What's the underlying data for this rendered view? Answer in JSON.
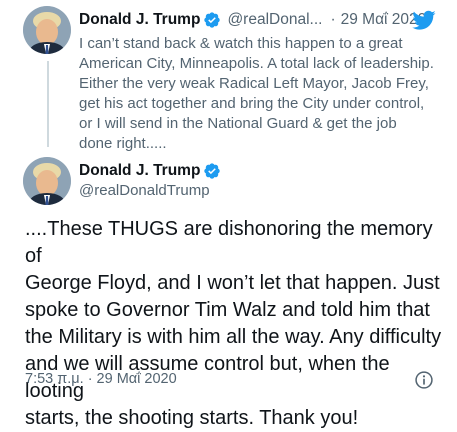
{
  "colors": {
    "twitter_blue": "#1d9bf0",
    "text_primary": "#0f1419",
    "text_secondary": "#536471",
    "thread_line": "#cfd9de"
  },
  "tweet_reply_context": {
    "author_name": "Donald J. Trump",
    "verified_icon": "verified-badge-icon",
    "handle": "@realDonal...",
    "separator": "·",
    "date": "29 Μαΐ 2020",
    "brand_icon": "twitter-bird-icon",
    "text": "I can’t stand back & watch this happen to a great\nAmerican City, Minneapolis. A total lack of leadership.\nEither the very weak Radical Left Mayor, Jacob Frey,\nget his act together and bring the City under control,\nor I will send in the National Guard & get the job\ndone right....."
  },
  "tweet_main": {
    "author_name": "Donald J. Trump",
    "verified_icon": "verified-badge-icon",
    "handle": "@realDonaldTrump",
    "text": "....These THUGS are dishonoring the memory of\nGeorge Floyd, and I won’t let that happen. Just\nspoke to Governor Tim Walz and told him that\nthe Military is with him all the way. Any difficulty\nand we will assume control but, when the looting\nstarts, the shooting starts. Thank you!",
    "timestamp": "7:53 π.μ. · 29 Μαΐ 2020",
    "info_icon": "info-icon"
  }
}
